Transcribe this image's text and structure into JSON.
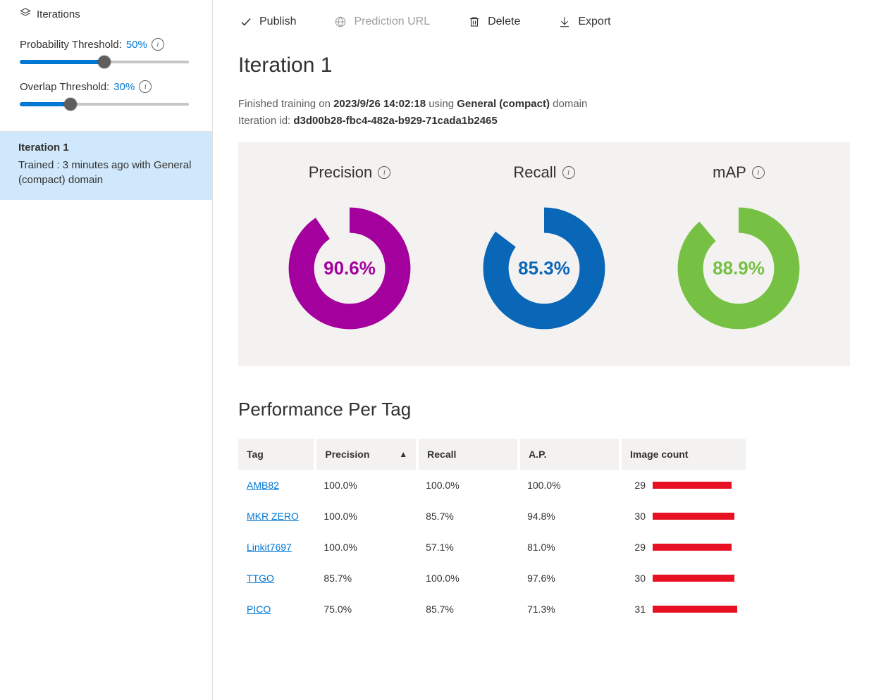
{
  "sidebar": {
    "header": "Iterations",
    "prob_label": "Probability Threshold:",
    "prob_value": "50%",
    "prob_pct": 50,
    "overlap_label": "Overlap Threshold:",
    "overlap_value": "30%",
    "overlap_pct": 30,
    "item": {
      "title": "Iteration 1",
      "subtitle": "Trained : 3 minutes ago with General (compact) domain"
    }
  },
  "toolbar": {
    "publish": "Publish",
    "prediction_url": "Prediction URL",
    "delete": "Delete",
    "export": "Export"
  },
  "main": {
    "title": "Iteration 1",
    "meta": {
      "prefix": "Finished training on ",
      "timestamp": "2023/9/26 14:02:18",
      "mid": " using ",
      "domain": "General (compact)",
      "suffix": " domain",
      "id_label": "Iteration id: ",
      "id": "d3d00b28-fbc4-482a-b929-71cada1b2465"
    }
  },
  "stats": {
    "precision_label": "Precision",
    "recall_label": "Recall",
    "map_label": "mAP",
    "precision_value": "90.6%",
    "recall_value": "85.3%",
    "map_value": "88.9%",
    "precision_pct": 90.6,
    "recall_pct": 85.3,
    "map_pct": 88.9,
    "colors": {
      "precision": "#a4009d",
      "recall": "#0a66b7",
      "map": "#76c043"
    }
  },
  "perf": {
    "title": "Performance Per Tag",
    "headers": {
      "tag": "Tag",
      "precision": "Precision",
      "recall": "Recall",
      "ap": "A.P.",
      "count": "Image count"
    },
    "max_count": 31,
    "rows": [
      {
        "tag": "AMB82",
        "precision": "100.0%",
        "recall": "100.0%",
        "ap": "100.0%",
        "count": 29
      },
      {
        "tag": "MKR ZERO",
        "precision": "100.0%",
        "recall": "85.7%",
        "ap": "94.8%",
        "count": 30
      },
      {
        "tag": "Linkit7697",
        "precision": "100.0%",
        "recall": "57.1%",
        "ap": "81.0%",
        "count": 29
      },
      {
        "tag": "TTGO",
        "precision": "85.7%",
        "recall": "100.0%",
        "ap": "97.6%",
        "count": 30
      },
      {
        "tag": "PICO",
        "precision": "75.0%",
        "recall": "85.7%",
        "ap": "71.3%",
        "count": 31
      }
    ]
  },
  "chart_data": [
    {
      "type": "pie",
      "title": "Precision",
      "values": [
        90.6,
        9.4
      ],
      "categories": [
        "value",
        "remainder"
      ],
      "color": "#a4009d"
    },
    {
      "type": "pie",
      "title": "Recall",
      "values": [
        85.3,
        14.7
      ],
      "categories": [
        "value",
        "remainder"
      ],
      "color": "#0a66b7"
    },
    {
      "type": "pie",
      "title": "mAP",
      "values": [
        88.9,
        11.1
      ],
      "categories": [
        "value",
        "remainder"
      ],
      "color": "#76c043"
    },
    {
      "type": "bar",
      "title": "Image count",
      "categories": [
        "AMB82",
        "MKR ZERO",
        "Linkit7697",
        "TTGO",
        "PICO"
      ],
      "values": [
        29,
        30,
        29,
        30,
        31
      ],
      "xlabel": "",
      "ylabel": "",
      "ylim": [
        0,
        31
      ]
    }
  ]
}
